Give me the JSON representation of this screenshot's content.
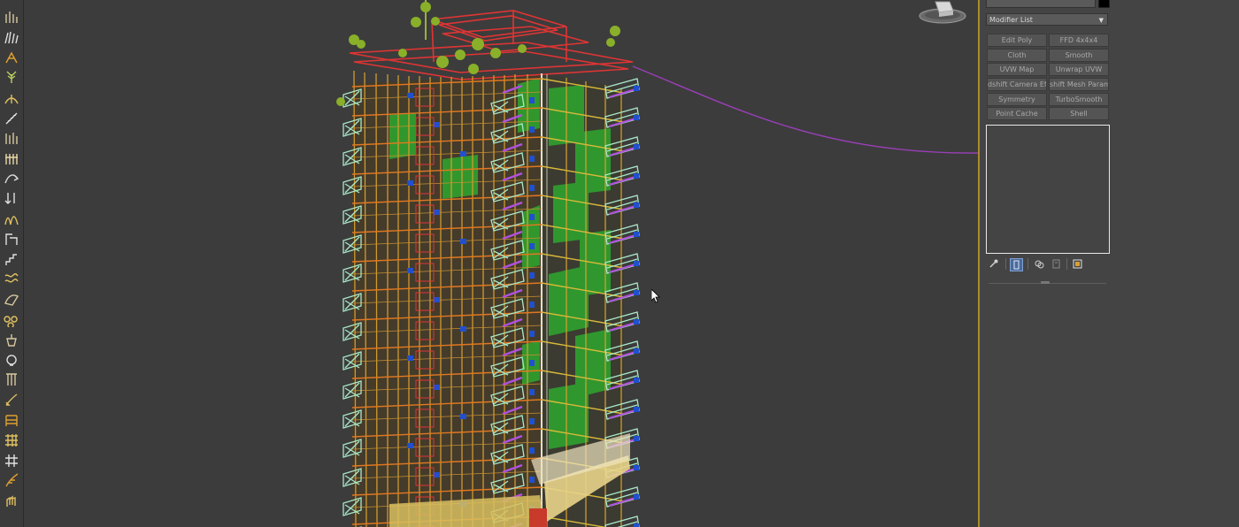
{
  "modifier_panel": {
    "modifier_list_label": "Modifier List",
    "buttons": [
      {
        "label": "Edit Poly"
      },
      {
        "label": "FFD 4x4x4"
      },
      {
        "label": "Cloth"
      },
      {
        "label": "Smooth"
      },
      {
        "label": "UVW Map"
      },
      {
        "label": "Unwrap UVW"
      },
      {
        "label": "dshift Camera Effe"
      },
      {
        "label": "shift Mesh Parame"
      },
      {
        "label": "Symmetry"
      },
      {
        "label": "TurboSmooth"
      },
      {
        "label": "Point Cache"
      },
      {
        "label": "Shell"
      }
    ]
  },
  "colors": {
    "viewport_bg": "#3c3c3c",
    "viewport_active_border": "#a88b2c",
    "wire_orange": "#e07820",
    "wire_yellow": "#d8b83a",
    "wire_red": "#e03434",
    "glass_green": "#2ea82e",
    "balcony_mint": "#a8e8c8",
    "accent_blue": "#2050d0",
    "accent_purple": "#b050e0",
    "spline_purple": "#9a3fb8"
  },
  "toolbar_icons": [
    "populate-icon",
    "grass-icon",
    "scatter-icon",
    "plant-icon",
    "shrub-icon",
    "fern-icon",
    "reed-icon",
    "fence-icon",
    "curve-icon",
    "arrow-down-icon",
    "tall-grass-icon",
    "crop-icon",
    "stair-icon",
    "wave-icon",
    "wing-icon",
    "cluster-icon",
    "bucket-icon",
    "sphere-icon",
    "pillar-icon",
    "brush-icon",
    "rack-icon",
    "mesh-icon",
    "grid-icon",
    "feather-icon",
    "hand-icon"
  ]
}
